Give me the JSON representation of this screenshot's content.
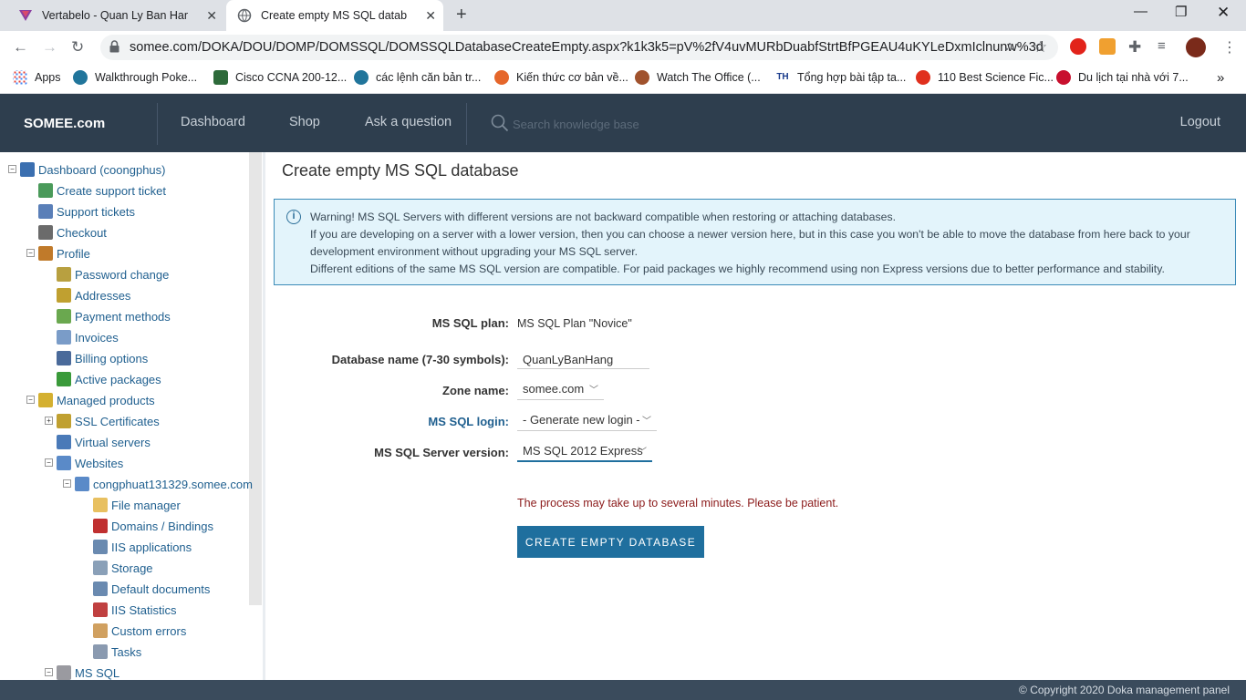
{
  "browser": {
    "tabs": [
      {
        "title": "Vertabelo - Quan Ly Ban Hang",
        "active": false
      },
      {
        "title": "Create empty MS SQL database",
        "active": true
      }
    ],
    "url": "somee.com/DOKA/DOU/DOMP/DOMSSQL/DOMSSQLDatabaseCreateEmpty.aspx?k1k3k5=pV%2fV4uvMURbDuabfStrtBfPGEAU4uKYLeDxmIclnunw%3d",
    "bookmarks": [
      {
        "label": "Apps",
        "icon": "apps-grid-icon"
      },
      {
        "label": "Walkthrough Poke...",
        "icon": "wordpress-icon"
      },
      {
        "label": "Cisco CCNA 200-12...",
        "icon": "pa-icon"
      },
      {
        "label": "các lệnh căn bản tr...",
        "icon": "wordpress-icon"
      },
      {
        "label": "Kiến thức cơ bản về...",
        "icon": "github-icon"
      },
      {
        "label": "Watch The Office (...",
        "icon": "person-icon"
      },
      {
        "label": "Tổng hợp bài tập ta...",
        "icon": "th-icon"
      },
      {
        "label": "110 Best Science Fic...",
        "icon": "tomato-icon"
      },
      {
        "label": "Du lịch tại nhà với 7...",
        "icon": "fourteen-icon"
      }
    ],
    "favicons": {
      "tab1": "vertabelo-icon",
      "tab2": "globe-icon"
    }
  },
  "topnav": {
    "brand": "SOMEE.com",
    "links": [
      "Dashboard",
      "Shop",
      "Ask a question"
    ],
    "search_placeholder": "Search knowledge base",
    "logout": "Logout",
    "bg_color": "#2e3e4e"
  },
  "sidebar": {
    "items": [
      {
        "label": "Dashboard (coongphus)",
        "icon": "user-icon",
        "toggle": "−"
      },
      {
        "label": "Create support ticket",
        "icon": "support-ticket-add-icon"
      },
      {
        "label": "Support tickets",
        "icon": "support-tickets-icon"
      },
      {
        "label": "Checkout",
        "icon": "cart-icon"
      },
      {
        "label": "Profile",
        "icon": "profile-icon",
        "toggle": "−"
      },
      {
        "label": "Password change",
        "icon": "password-icon"
      },
      {
        "label": "Addresses",
        "icon": "address-book-icon"
      },
      {
        "label": "Payment methods",
        "icon": "payment-icon"
      },
      {
        "label": "Invoices",
        "icon": "invoice-icon"
      },
      {
        "label": "Billing options",
        "icon": "calculator-icon"
      },
      {
        "label": "Active packages",
        "icon": "active-packages-icon"
      },
      {
        "label": "Managed products",
        "icon": "folder-icon",
        "toggle": "−"
      },
      {
        "label": "SSL Certificates",
        "icon": "certificate-icon",
        "toggle": "+"
      },
      {
        "label": "Virtual servers",
        "icon": "server-icon"
      },
      {
        "label": "Websites",
        "icon": "websites-icon",
        "toggle": "−"
      },
      {
        "label": "congphuat131329.somee.com",
        "icon": "website-icon",
        "toggle": "−"
      },
      {
        "label": "File manager",
        "icon": "file-manager-icon"
      },
      {
        "label": "Domains / Bindings",
        "icon": "domains-icon"
      },
      {
        "label": "IIS applications",
        "icon": "iis-apps-icon"
      },
      {
        "label": "Storage",
        "icon": "storage-icon"
      },
      {
        "label": "Default documents",
        "icon": "documents-icon"
      },
      {
        "label": "IIS Statistics",
        "icon": "statistics-icon"
      },
      {
        "label": "Custom errors",
        "icon": "custom-errors-icon"
      },
      {
        "label": "Tasks",
        "icon": "tasks-icon"
      },
      {
        "label": "MS SQL",
        "icon": "database-icon",
        "toggle": "−"
      }
    ]
  },
  "main": {
    "title": "Create empty MS SQL database",
    "alert": {
      "line1": "Warning! MS SQL Servers with different versions are not backward compatible when restoring or attaching databases.",
      "line2": "If you are developing on a server with a lower version, then you can choose a newer version here, but in this case you won't be able to move the database from here back to your development environment without upgrading your MS SQL server.",
      "line3": "Different editions of the same MS SQL version are compatible. For paid packages we highly recommend using non Express versions due to better performance and stability."
    },
    "form": {
      "plan_label": "MS SQL plan:",
      "plan_value": "MS SQL Plan \"Novice\"",
      "dbname_label": "Database name (7-30 symbols):",
      "dbname_value": "QuanLyBanHang",
      "zone_label": "Zone name:",
      "zone_value": "somee.com",
      "login_label": "MS SQL login:",
      "login_value": "- Generate new login -",
      "version_label": "MS SQL Server version:",
      "version_value": "MS SQL 2012 Express"
    },
    "note": "The process may take up to several minutes. Please be patient.",
    "create_button": "CREATE EMPTY DATABASE",
    "accent_color": "#1f6f9e"
  },
  "footer": {
    "copyright": "© Copyright 2020 Doka management panel"
  }
}
